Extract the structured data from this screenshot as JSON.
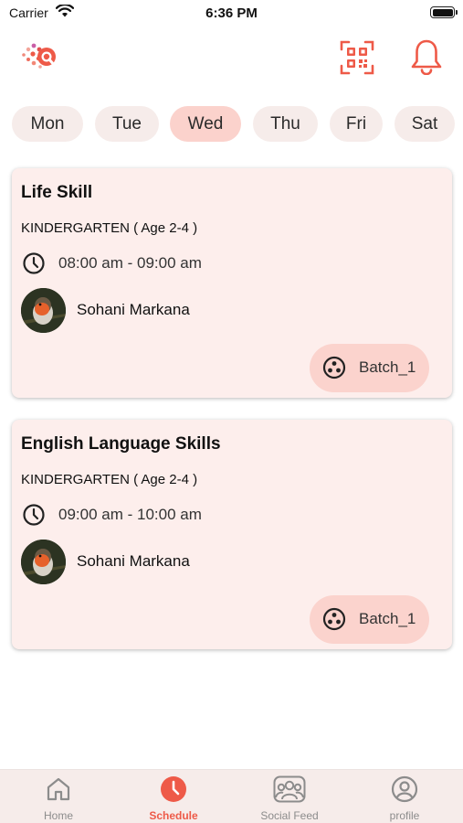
{
  "status_bar": {
    "carrier": "Carrier",
    "time": "6:36 PM"
  },
  "header": {
    "logo_icon": "app-logo-icon",
    "qr_icon": "qr-scan-icon",
    "bell_icon": "bell-icon"
  },
  "days": [
    {
      "label": "Mon",
      "selected": false
    },
    {
      "label": "Tue",
      "selected": false
    },
    {
      "label": "Wed",
      "selected": true
    },
    {
      "label": "Thu",
      "selected": false
    },
    {
      "label": "Fri",
      "selected": false
    },
    {
      "label": "Sat",
      "selected": false
    }
  ],
  "classes": [
    {
      "title": "Life Skill",
      "level": "KINDERGARTEN ( Age 2-4 )",
      "time": "08:00 am - 09:00 am",
      "teacher": "Sohani Markana",
      "batch": "Batch_1"
    },
    {
      "title": "English Language Skills",
      "level": "KINDERGARTEN ( Age 2-4 )",
      "time": "09:00 am - 10:00 am",
      "teacher": "Sohani Markana",
      "batch": "Batch_1"
    }
  ],
  "bottom_nav": [
    {
      "label": "Home",
      "icon": "home-icon",
      "active": false
    },
    {
      "label": "Schedule",
      "icon": "clock-icon",
      "active": true
    },
    {
      "label": "Social Feed",
      "icon": "people-icon",
      "active": false
    },
    {
      "label": "profile",
      "icon": "profile-icon",
      "active": false
    }
  ],
  "colors": {
    "accent": "#ee5a48",
    "card_bg": "#fdeeec",
    "pill_bg": "#f6ecea",
    "pill_active_bg": "#fbd2cc",
    "nav_inactive": "#8c8c8c"
  }
}
